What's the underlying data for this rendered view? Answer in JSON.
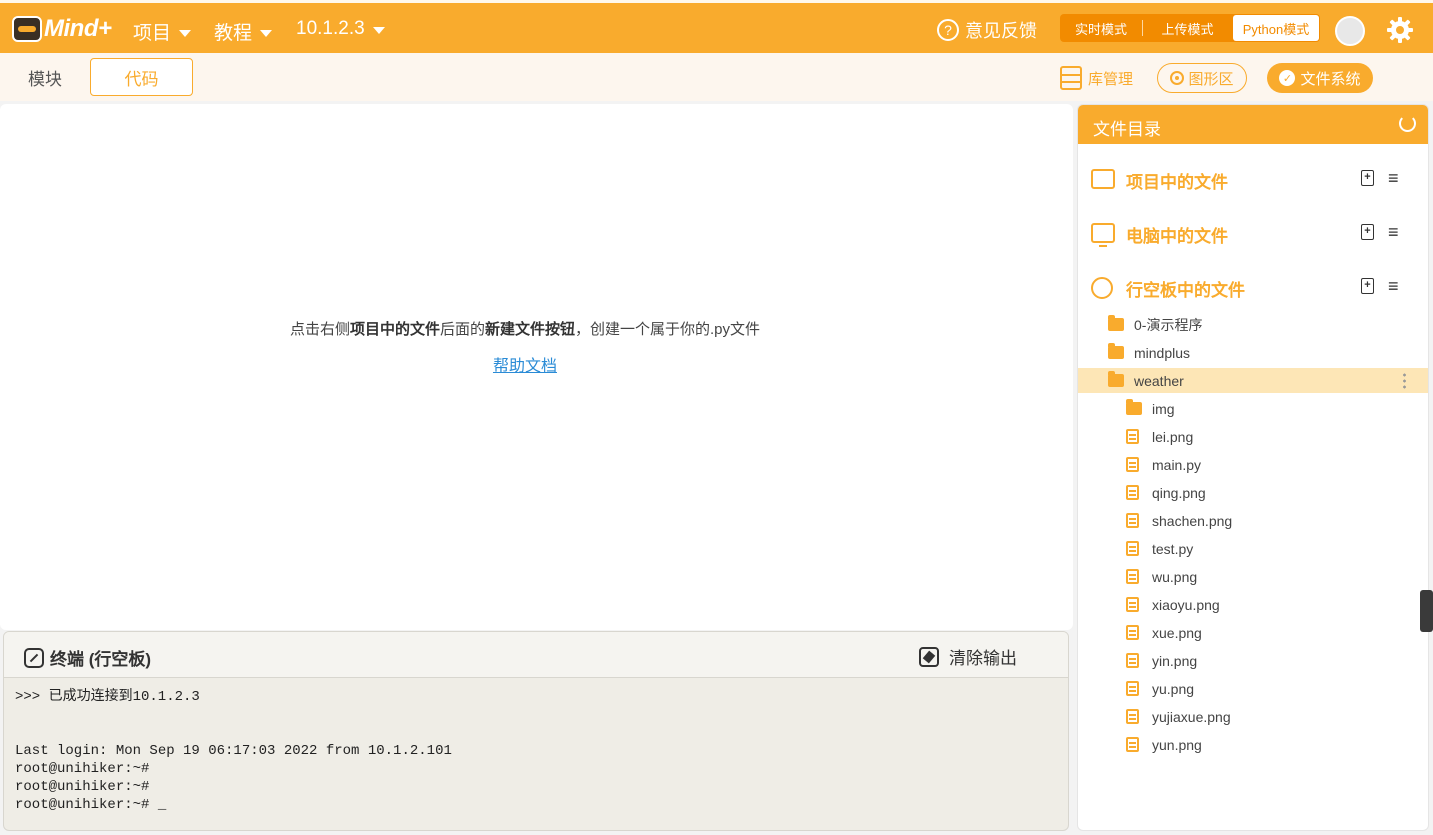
{
  "app": {
    "logo_text": "Mind+"
  },
  "topbar": {
    "menu_project": "项目",
    "menu_tutorial": "教程",
    "menu_device": "10.1.2.3",
    "feedback": "意见反馈",
    "modes": [
      "实时模式",
      "上传模式",
      "Python模式"
    ],
    "active_mode": "Python模式"
  },
  "tabs": {
    "blocks": "模块",
    "code": "代码",
    "active": "代码"
  },
  "right_buttons": {
    "library": "库管理",
    "graphics": "图形区",
    "filesystem": "文件系统"
  },
  "editor": {
    "hint_prefix": "点击右侧",
    "hint_bold1": "项目中的文件",
    "hint_mid": "后面的",
    "hint_bold2": "新建文件按钮",
    "hint_suffix": "，创建一个属于你的.py文件",
    "help_link": "帮助文档"
  },
  "terminal": {
    "title": "终端 (行空板)",
    "clear_label": "清除输出",
    "lines": [
      ">>> 已成功连接到10.1.2.3",
      "",
      "",
      "Last login: Mon Sep 19 06:17:03 2022 from 10.1.2.101",
      "root@unihiker:~#",
      "root@unihiker:~#",
      "root@unihiker:~# _"
    ]
  },
  "panel": {
    "title": "文件目录",
    "sections": [
      "项目中的文件",
      "电脑中的文件",
      "行空板中的文件"
    ],
    "tree": [
      {
        "name": "0-演示程序",
        "type": "folder",
        "depth": 0
      },
      {
        "name": "mindplus",
        "type": "folder",
        "depth": 0
      },
      {
        "name": "weather",
        "type": "folder",
        "depth": 0,
        "selected": true
      },
      {
        "name": "img",
        "type": "folder",
        "depth": 1
      },
      {
        "name": "lei.png",
        "type": "file",
        "depth": 1
      },
      {
        "name": "main.py",
        "type": "file",
        "depth": 1
      },
      {
        "name": "qing.png",
        "type": "file",
        "depth": 1
      },
      {
        "name": "shachen.png",
        "type": "file",
        "depth": 1
      },
      {
        "name": "test.py",
        "type": "file",
        "depth": 1
      },
      {
        "name": "wu.png",
        "type": "file",
        "depth": 1
      },
      {
        "name": "xiaoyu.png",
        "type": "file",
        "depth": 1
      },
      {
        "name": "xue.png",
        "type": "file",
        "depth": 1
      },
      {
        "name": "yin.png",
        "type": "file",
        "depth": 1
      },
      {
        "name": "yu.png",
        "type": "file",
        "depth": 1
      },
      {
        "name": "yujiaxue.png",
        "type": "file",
        "depth": 1
      },
      {
        "name": "yun.png",
        "type": "file",
        "depth": 1
      }
    ]
  },
  "colors": {
    "accent": "#f9ab2d",
    "mode_bg": "#f28b00",
    "link": "#2a8bd6",
    "terminal_bg": "#efede6"
  }
}
